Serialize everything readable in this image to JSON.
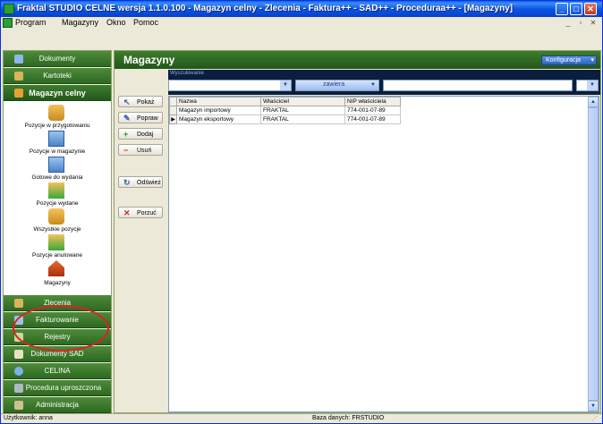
{
  "window": {
    "title": "Fraktal STUDIO CELNE   wersja 1.1.0.100 - Magazyn celny - Zlecenia - Faktura++ - SAD++ - Proceduraa++ - [Magazyny]",
    "controls": {
      "minimize": "_",
      "maximize": "□",
      "close": "✕"
    }
  },
  "menubar": {
    "items": [
      "Program",
      "Magazyny",
      "Okno",
      "Pomoc"
    ],
    "mdi_controls": [
      "_",
      "▫",
      "✕"
    ]
  },
  "sidebar": {
    "top_buttons": [
      "Dokumenty",
      "Kartoteki",
      "Magazyn celny"
    ],
    "items": [
      "Pozycje w przygotowaniu",
      "Pozycje w magazynie",
      "Gotowe do wydania",
      "Pozycje wydane",
      "Wszystkie pozycje",
      "Pozycje anulowane",
      "Magazyny"
    ],
    "bottom_buttons": [
      "Zlecenia",
      "Fakturowanie",
      "Rejestry",
      "Dokumenty SAD",
      "CELINA",
      "Procedura uproszczona",
      "Administracja"
    ]
  },
  "content": {
    "title": "Magazyny",
    "konfiguracja": "Konfiguracja",
    "search": {
      "title": "Wyszukiwanie",
      "operator": "zawiera",
      "value": ""
    },
    "actions": [
      "Pokaż",
      "Popraw",
      "Dodaj",
      "Usuń",
      "Odśwież",
      "Porzuć"
    ],
    "grid": {
      "columns": [
        "Nazwa",
        "Właściciel",
        "NIP właściciela"
      ],
      "rows": [
        [
          "Magazyn importowy",
          "FRAKTAL",
          "774-001-07-89"
        ],
        [
          "Magazyn eksportowy",
          "FRAKTAL",
          "774-001-07-89"
        ]
      ]
    }
  },
  "status": {
    "user": "Użytkownik: anna",
    "database": "Baza danych: FRSTUDIO"
  }
}
